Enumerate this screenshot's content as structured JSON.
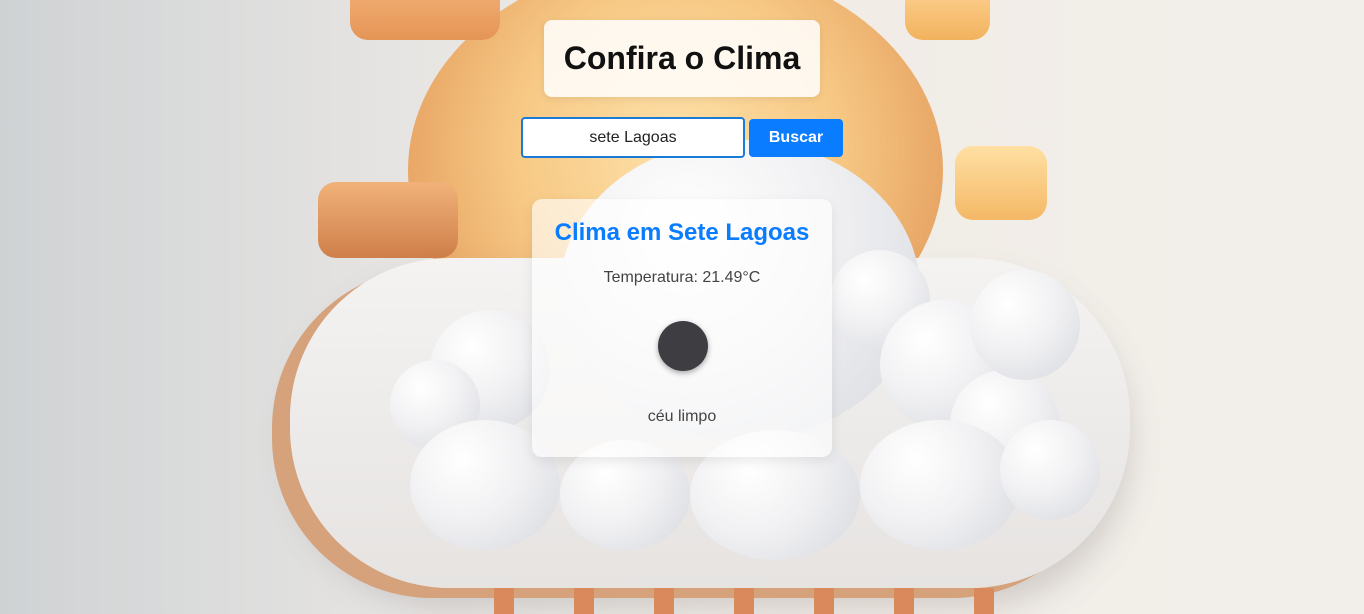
{
  "header": {
    "title": "Confira o Clima"
  },
  "search": {
    "value": "sete Lagoas",
    "button_label": "Buscar"
  },
  "weather": {
    "city_title": "Clima em Sete Lagoas",
    "temperature_text": "Temperatura: 21.49°C",
    "description": "céu limpo",
    "icon": "weather-icon"
  },
  "colors": {
    "accent": "#0a7cff",
    "title_text": "#111111",
    "icon": "#3e3e42"
  }
}
